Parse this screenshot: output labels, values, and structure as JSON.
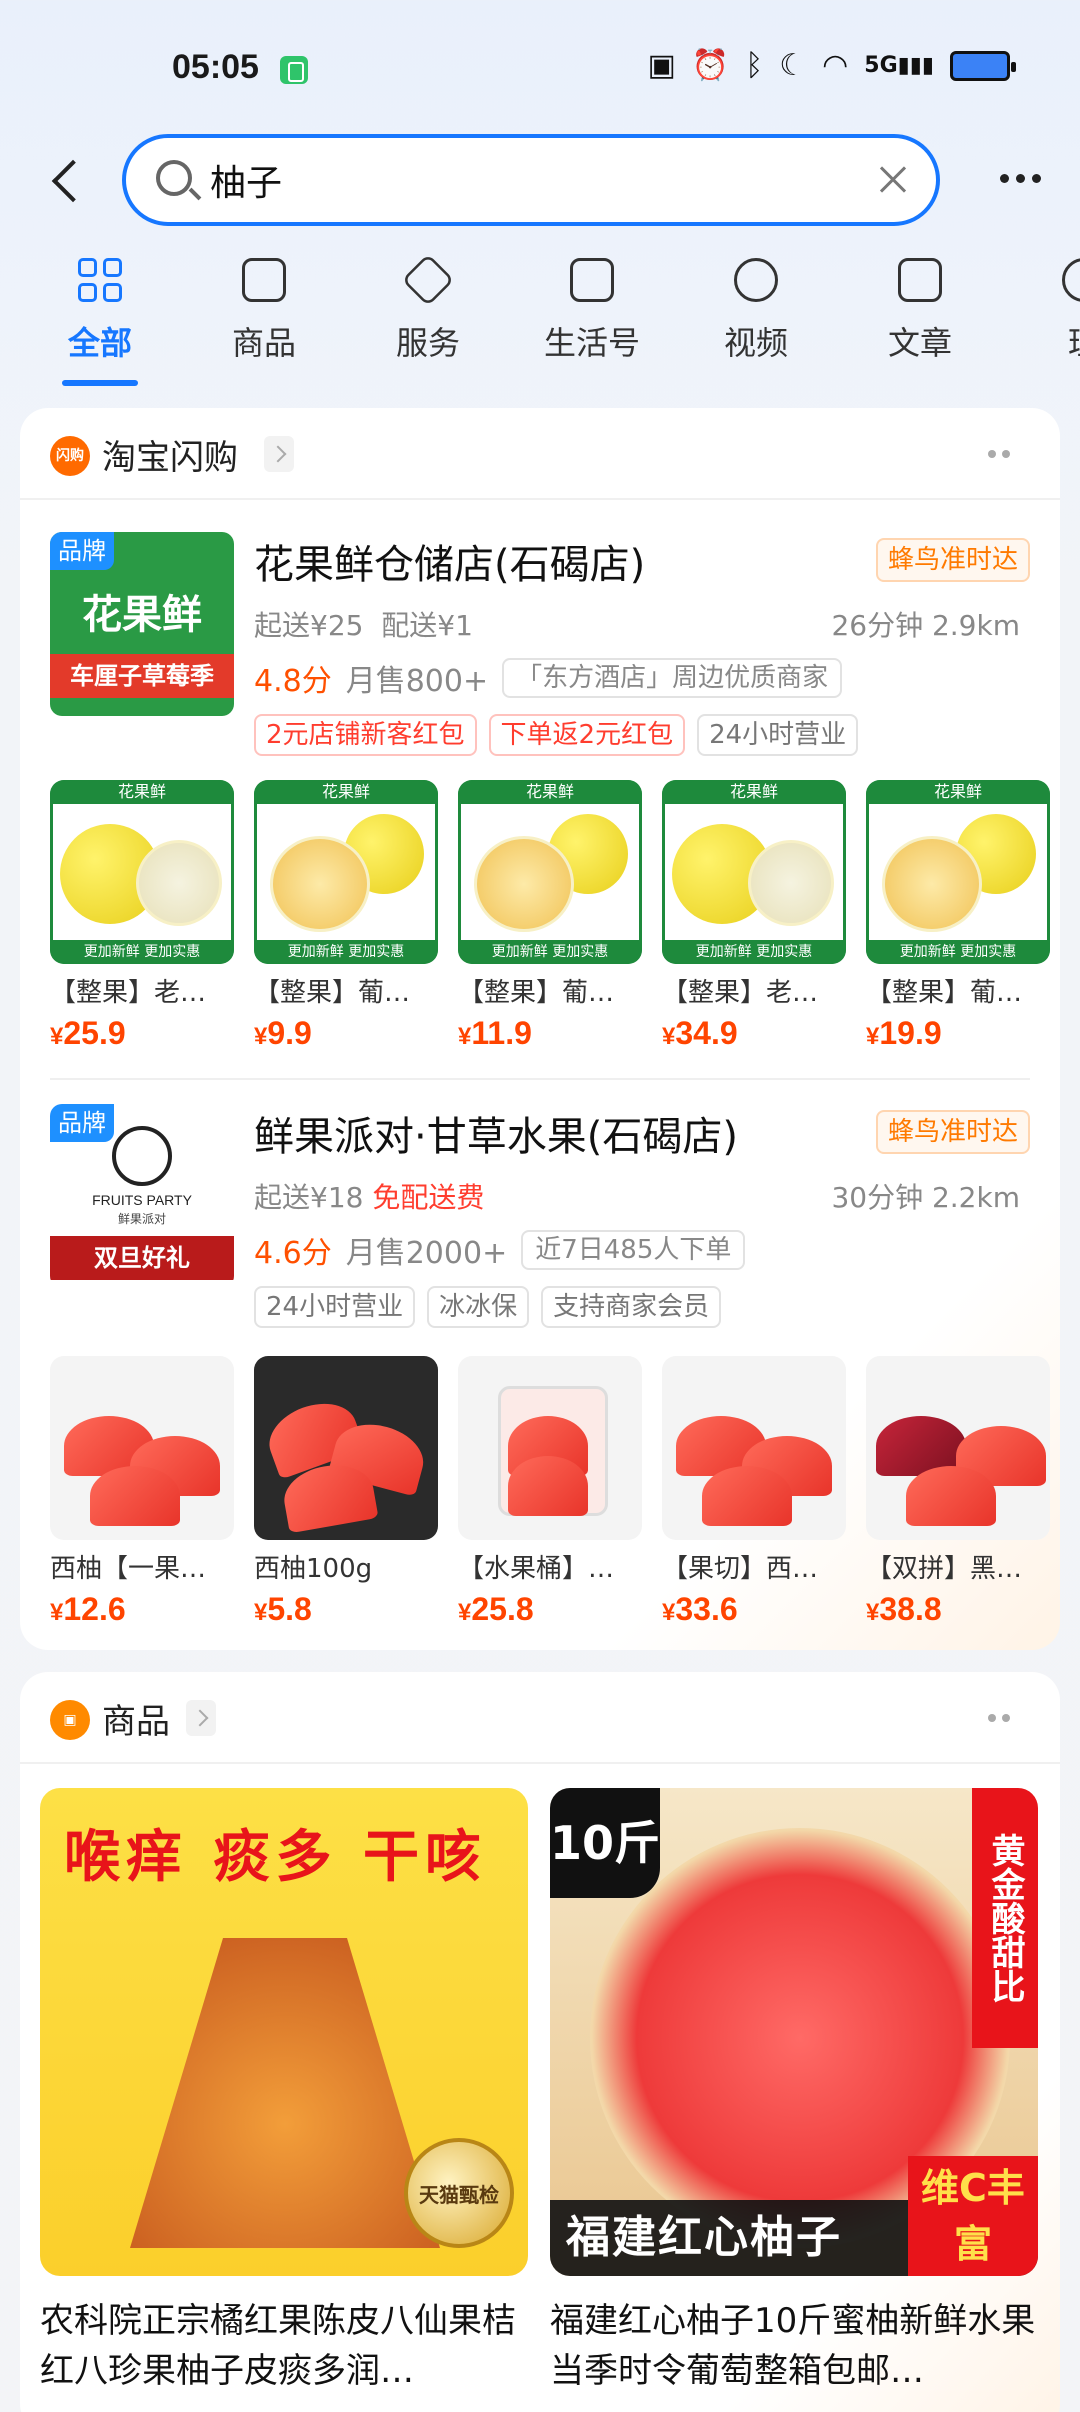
{
  "status_bar": {
    "time": "05:05",
    "network": "5G"
  },
  "header": {
    "search": {
      "value": "柚子",
      "placeholder": ""
    }
  },
  "tabs": [
    {
      "label": "全部",
      "icon": "grid-icon",
      "active": true
    },
    {
      "label": "商品",
      "icon": "bag-icon"
    },
    {
      "label": "服务",
      "icon": "cube-icon"
    },
    {
      "label": "生活号",
      "icon": "chat-plus-icon"
    },
    {
      "label": "视频",
      "icon": "play-icon"
    },
    {
      "label": "文章",
      "icon": "article-icon"
    },
    {
      "label": "理",
      "icon": "partial-icon"
    }
  ],
  "flash_section": {
    "title": "淘宝闪购",
    "icon_label": "闪购",
    "shops": [
      {
        "brand_tag": "品牌",
        "logo_text": "花果鲜",
        "logo_sub": "车厘子草莓季",
        "name": "花果鲜仓储店(石碣店)",
        "badge": "蜂鸟准时达",
        "min_order": "起送¥25",
        "delivery_fee": "配送¥1",
        "eta_distance": "26分钟 2.9km",
        "rating": "4.8分",
        "monthly_sales": "月售800+",
        "highlight": "「东方酒店」周边优质商家",
        "tags": [
          {
            "text": "2元店铺新客红包",
            "style": "red"
          },
          {
            "text": "下单返2元红包",
            "style": "red"
          },
          {
            "text": "24小时营业",
            "style": "grey"
          }
        ],
        "products": [
          {
            "name": "【整果】老…",
            "price": "25.9",
            "variant": "whole"
          },
          {
            "name": "【整果】葡…",
            "price": "9.9",
            "variant": "open"
          },
          {
            "name": "【整果】葡…",
            "price": "11.9",
            "variant": "open"
          },
          {
            "name": "【整果】老…",
            "price": "34.9",
            "variant": "whole"
          },
          {
            "name": "【整果】葡…",
            "price": "19.9",
            "variant": "open"
          }
        ],
        "product_banner_top": "花果鲜",
        "product_banner_bottom": "更加新鲜 更加实惠"
      },
      {
        "brand_tag": "品牌",
        "logo_text": "FRUITS PARTY",
        "logo_sub_cn": "鲜果派对",
        "logo_sub": "双旦好礼",
        "name": "鲜果派对·甘草水果(石碣店)",
        "badge": "蜂鸟准时达",
        "min_order": "起送¥18",
        "delivery_fee": "免配送费",
        "eta_distance": "30分钟 2.2km",
        "rating": "4.6分",
        "monthly_sales": "月售2000+",
        "highlight": "近7日485人下单",
        "tags": [
          {
            "text": "24小时营业",
            "style": "grey"
          },
          {
            "text": "冰冰保",
            "style": "grey"
          },
          {
            "text": "支持商家会员",
            "style": "grey"
          }
        ],
        "products": [
          {
            "name": "西柚【一果…",
            "price": "12.6"
          },
          {
            "name": "西柚100g",
            "price": "5.8"
          },
          {
            "name": "【水果桶】…",
            "price": "25.8"
          },
          {
            "name": "【果切】西…",
            "price": "33.6"
          },
          {
            "name": "【双拼】黑…",
            "price": "38.8"
          }
        ]
      }
    ]
  },
  "goods_section": {
    "title": "商品",
    "items": [
      {
        "banner": "喉痒 痰多 干咳",
        "seal": "天猫甄检",
        "title": "农科院正宗橘红果陈皮八仙果桔红八珍果柚子皮痰多润…"
      },
      {
        "weight": "10斤",
        "ratio": "黄金酸甜比",
        "banner": "福建红心柚子",
        "vitc": "维C丰富",
        "title": "福建红心柚子10斤蜜柚新鲜水果当季时令葡萄整箱包邮…"
      }
    ]
  },
  "colors": {
    "accent": "#1677ff",
    "price": "#ff4400",
    "badge_orange": "#ff7a00",
    "tag_red": "#ff3d2e"
  }
}
